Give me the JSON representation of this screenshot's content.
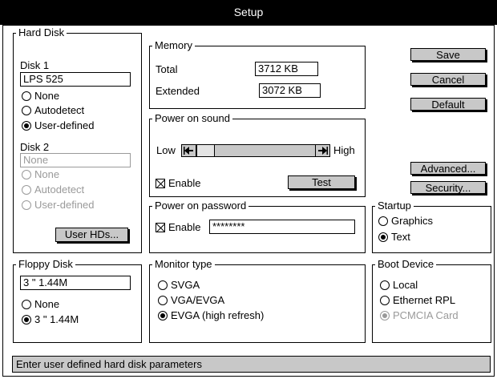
{
  "window": {
    "title": "Setup"
  },
  "hard_disk": {
    "legend": "Hard Disk",
    "disk1": {
      "label": "Disk 1",
      "value": "LPS 525",
      "options": [
        "None",
        "Autodetect",
        "User-defined"
      ]
    },
    "disk2": {
      "label": "Disk 2",
      "value": "None",
      "options": [
        "None",
        "Autodetect",
        "User-defined"
      ]
    },
    "user_hds_label": "User HDs..."
  },
  "memory": {
    "legend": "Memory",
    "total_label": "Total",
    "total_value": "3712 KB",
    "extended_label": "Extended",
    "extended_value": "3072 KB"
  },
  "power_on_sound": {
    "legend": "Power on sound",
    "low_label": "Low",
    "high_label": "High",
    "enable_label": "Enable",
    "test_label": "Test"
  },
  "power_on_password": {
    "legend": "Power on password",
    "enable_label": "Enable",
    "password_value": "********"
  },
  "right_buttons": {
    "save": "Save",
    "cancel": "Cancel",
    "default": "Default",
    "advanced": "Advanced...",
    "security": "Security..."
  },
  "startup": {
    "legend": "Startup",
    "options": [
      "Graphics",
      "Text"
    ]
  },
  "floppy_disk": {
    "legend": "Floppy Disk",
    "value": "3 \" 1.44M",
    "options": [
      "None",
      "3 \" 1.44M"
    ]
  },
  "monitor_type": {
    "legend": "Monitor type",
    "options": [
      "SVGA",
      "VGA/EVGA",
      "EVGA (high refresh)"
    ]
  },
  "boot_device": {
    "legend": "Boot Device",
    "options": [
      "Local",
      "Ethernet RPL",
      "PCMCIA Card"
    ]
  },
  "status_bar": {
    "text": "Enter user defined hard disk parameters"
  },
  "icons": {
    "slider_left": "left-arrow-icon",
    "slider_right": "right-arrow-icon"
  }
}
